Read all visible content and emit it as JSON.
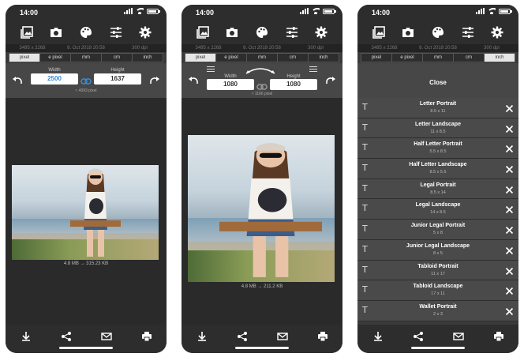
{
  "status": {
    "time": "14:00"
  },
  "info": {
    "original_size": "3495 x 2268",
    "date": "8. Oct 2018 20:58",
    "dpi": "300 dpi"
  },
  "units": [
    "pixel",
    "e pixel",
    "mm",
    "cm",
    "inch"
  ],
  "screen1": {
    "active_unit_index": 0,
    "width_label": "Width",
    "height_label": "Height",
    "width_value": "2500",
    "height_value": "1637",
    "megapixels": "≈ 4093 pixel",
    "file_info": "4.8 MB → 315.23 KB"
  },
  "screen2": {
    "active_unit_index": 0,
    "width_label": "Width",
    "height_label": "Height",
    "width_value": "1080",
    "height_value": "1080",
    "megapixels": "≈ 1166 pixel",
    "file_info": "4.8 MB → 211.2 KB"
  },
  "screen3": {
    "active_unit_index": 4,
    "close_label": "Close",
    "paper_sizes": [
      {
        "name": "Letter Portrait",
        "size": "8.5 x 11"
      },
      {
        "name": "Letter Landscape",
        "size": "11 x 8.5"
      },
      {
        "name": "Half Letter Portrait",
        "size": "5.5 x 8.5"
      },
      {
        "name": "Half Letter Landscape",
        "size": "8.5 x 5.5"
      },
      {
        "name": "Legal Portrait",
        "size": "8.5 x 14"
      },
      {
        "name": "Legal Landscape",
        "size": "14 x 8.5"
      },
      {
        "name": "Junior Legal Portrait",
        "size": "5 x 8"
      },
      {
        "name": "Junior Legal Landscape",
        "size": "8 x 5"
      },
      {
        "name": "Tabloid Portrait",
        "size": "11 x 17"
      },
      {
        "name": "Tabloid Landscape",
        "size": "17 x 11"
      },
      {
        "name": "Wallet Portrait",
        "size": "2 x 3"
      }
    ]
  },
  "icons": {
    "toolbar": [
      "gallery-icon",
      "camera-icon",
      "palette-icon",
      "sliders-icon",
      "gear-icon"
    ],
    "bottom": [
      "download-icon",
      "share-icon",
      "mail-icon",
      "print-icon"
    ]
  }
}
